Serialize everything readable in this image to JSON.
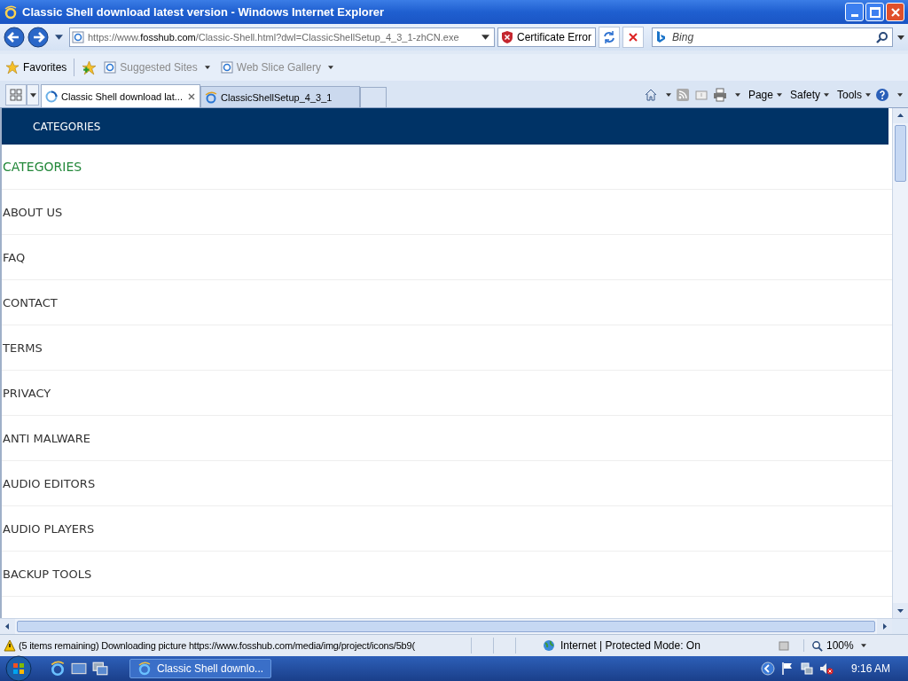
{
  "window": {
    "title": "Classic Shell download latest version - Windows Internet Explorer"
  },
  "address_bar": {
    "url_prefix": "https://www.",
    "url_domain": "fosshub.com",
    "url_rest": "/Classic-Shell.html?dwl=ClassicShellSetup_4_3_1-zhCN.exe",
    "certificate": "Certificate Error"
  },
  "search": {
    "placeholder": "Bing"
  },
  "favorites_bar": {
    "favorites": "Favorites",
    "items": [
      "Suggested Sites",
      "Web Slice Gallery"
    ]
  },
  "tabs": [
    {
      "label": "Classic Shell download lat...",
      "selected": true,
      "loading": true
    },
    {
      "label": "ClassicShellSetup_4_3_1",
      "selected": false,
      "loading": false
    }
  ],
  "command_bar": [
    "Page",
    "Safety",
    "Tools"
  ],
  "page": {
    "header": "CATEGORIES",
    "menu": [
      {
        "label": "CATEGORIES",
        "kind": "heading"
      },
      {
        "label": "ABOUT US",
        "kind": "link"
      },
      {
        "label": "FAQ",
        "kind": "link"
      },
      {
        "label": "CONTACT",
        "kind": "link"
      },
      {
        "label": "TERMS",
        "kind": "link"
      },
      {
        "label": "PRIVACY",
        "kind": "link"
      },
      {
        "label": "ANTI MALWARE",
        "kind": "link"
      },
      {
        "label": "AUDIO EDITORS",
        "kind": "link"
      },
      {
        "label": "AUDIO PLAYERS",
        "kind": "link"
      },
      {
        "label": "BACKUP TOOLS",
        "kind": "link"
      }
    ]
  },
  "status_bar": {
    "message": "(5 items remaining) Downloading picture https://www.fosshub.com/media/img/project/icons/5b9(",
    "zone": "Internet | Protected Mode: On",
    "zoom": "100%"
  },
  "taskbar": {
    "window": "Classic Shell downlo...",
    "clock": "9:16 AM"
  }
}
